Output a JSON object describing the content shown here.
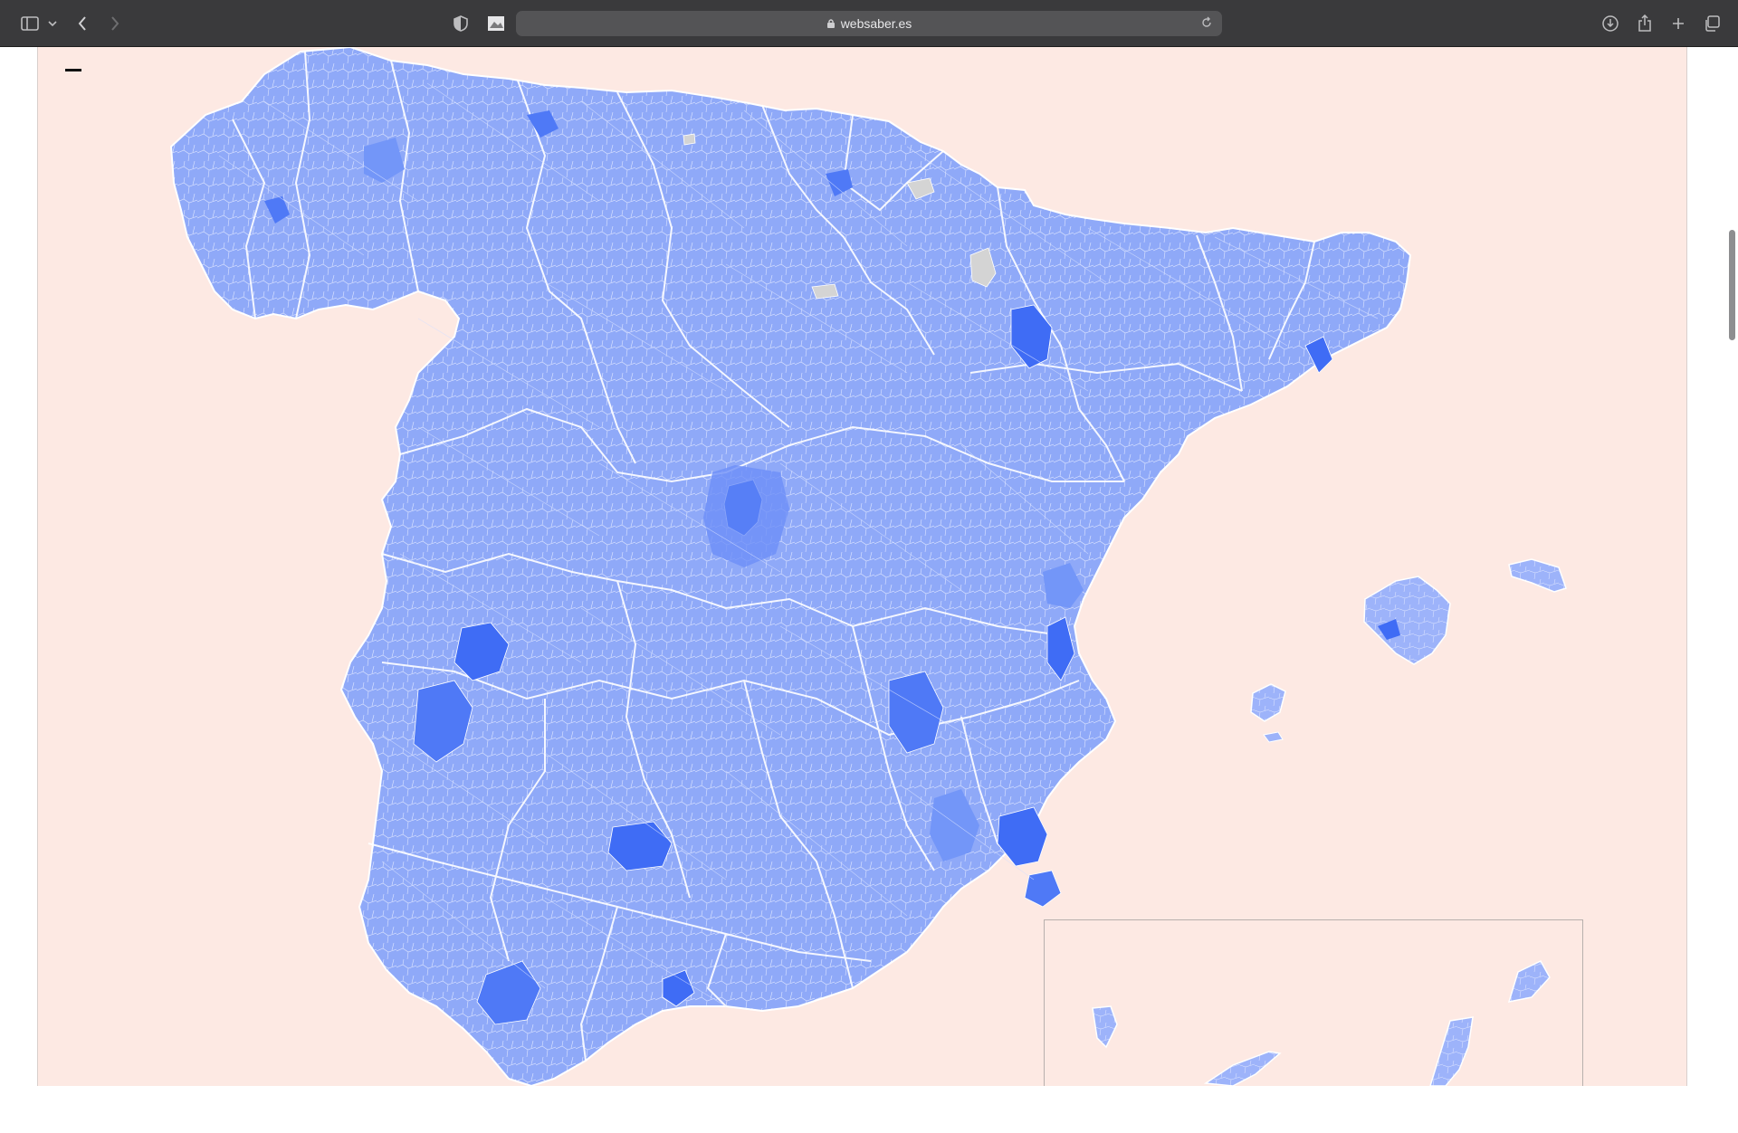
{
  "browser": {
    "url": "websaber.es",
    "icons": {
      "sidebar": "sidebar-icon",
      "sidebar_menu": "chevron-down-icon",
      "back": "chevron-left-icon",
      "forward": "chevron-right-icon",
      "privacy": "shield-icon",
      "extension": "image-extension-icon",
      "lock": "lock-icon",
      "reload": "reload-icon",
      "downloads": "download-icon",
      "share": "share-icon",
      "new_tab": "plus-icon",
      "tabs": "tabs-overview-icon"
    }
  },
  "map": {
    "background": "#fde9e3",
    "region_fill": "#8fa9f8",
    "region_stroke": "#ffffff",
    "intense_fill": "#0043f0",
    "dark_fill": "#3f6cf5",
    "mid_fill": "#6d8ff7",
    "no_data_fill": "#d4d4d4",
    "legend_minimize": "minimize-control"
  }
}
